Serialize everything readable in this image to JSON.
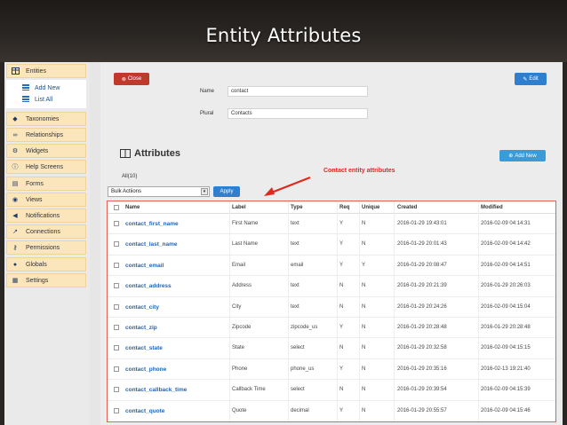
{
  "slide": {
    "title": "Entity Attributes"
  },
  "sidebar": {
    "items": [
      {
        "label": "Entities",
        "icon": "table-icon"
      },
      {
        "label": "Taxonomies",
        "icon": "tag-icon"
      },
      {
        "label": "Relationships",
        "icon": "link-icon"
      },
      {
        "label": "Widgets",
        "icon": "gear-icon"
      },
      {
        "label": "Help Screens",
        "icon": "info-icon"
      },
      {
        "label": "Forms",
        "icon": "form-icon"
      },
      {
        "label": "Views",
        "icon": "eye-icon"
      },
      {
        "label": "Notifications",
        "icon": "megaphone-icon"
      },
      {
        "label": "Connections",
        "icon": "external-link-icon"
      },
      {
        "label": "Permissions",
        "icon": "key-icon"
      },
      {
        "label": "Globals",
        "icon": "globe-icon"
      },
      {
        "label": "Settings",
        "icon": "settings-icon"
      }
    ],
    "subitems": [
      {
        "label": "Add New",
        "icon": "list-icon"
      },
      {
        "label": "List All",
        "icon": "list-icon"
      }
    ]
  },
  "toolbar": {
    "close_label": "Close",
    "edit_label": "Edit"
  },
  "form": {
    "name_label": "Name",
    "name_value": "contact",
    "plural_label": "Plural",
    "plural_value": "Contacts"
  },
  "attributes": {
    "title": "Attributes",
    "add_new_label": "Add New",
    "all_count": "All(10)",
    "bulk_action": "Bulk Actiions",
    "apply_label": "Apply",
    "annotation": "Contact entity attributes"
  },
  "table": {
    "headers": [
      "Name",
      "Label",
      "Type",
      "Req",
      "Unique",
      "Created",
      "Modified"
    ],
    "rows": [
      [
        "contact_first_name",
        "First Name",
        "text",
        "Y",
        "N",
        "2016-01-29 19:43:01",
        "2016-02-09 04:14:31"
      ],
      [
        "contact_last_name",
        "Last Name",
        "text",
        "Y",
        "N",
        "2016-01-29 20:01:43",
        "2016-02-09 04:14:42"
      ],
      [
        "contact_email",
        "Email",
        "email",
        "Y",
        "Y",
        "2016-01-29 20:08:47",
        "2016-02-09 04:14:51"
      ],
      [
        "contact_address",
        "Address",
        "text",
        "N",
        "N",
        "2016-01-29 20:21:39",
        "2016-01-29 20:26:03"
      ],
      [
        "contact_city",
        "City",
        "text",
        "N",
        "N",
        "2016-01-29 20:24:26",
        "2016-02-09 04:15:04"
      ],
      [
        "contact_zip",
        "Zipcode",
        "zipcode_us",
        "Y",
        "N",
        "2016-01-29 20:28:48",
        "2016-01-29 20:28:48"
      ],
      [
        "contact_state",
        "State",
        "select",
        "N",
        "N",
        "2016-01-29 20:32:58",
        "2016-02-09 04:15:15"
      ],
      [
        "contact_phone",
        "Phone",
        "phone_us",
        "Y",
        "N",
        "2016-01-29 20:35:16",
        "2016-02-13 19:21:40"
      ],
      [
        "contact_callback_time",
        "Callback Time",
        "select",
        "N",
        "N",
        "2016-01-29 20:39:54",
        "2016-02-09 04:15:39"
      ],
      [
        "contact_quote",
        "Quote",
        "decimal",
        "Y",
        "N",
        "2016-01-29 20:55:57",
        "2016-02-09 04:15:46"
      ]
    ]
  }
}
